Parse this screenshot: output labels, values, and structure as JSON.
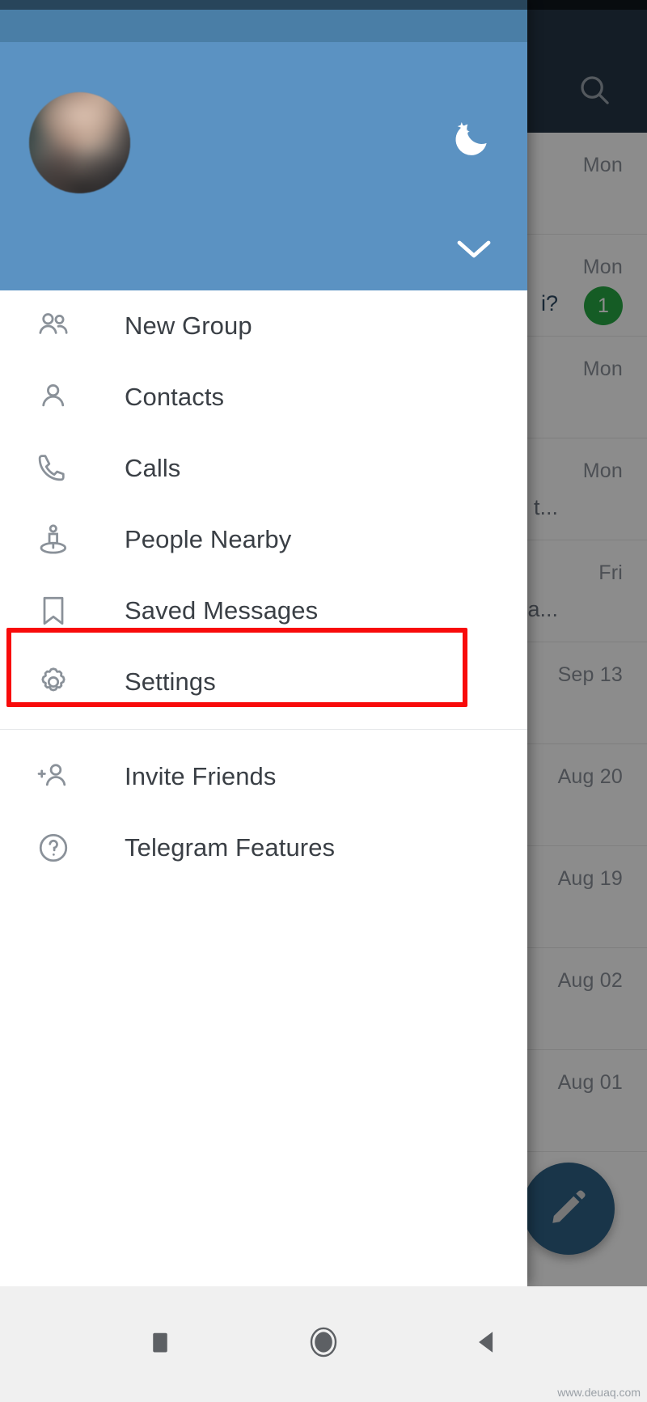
{
  "app": {
    "name": "Telegram",
    "watermark": "www.deuaq.com"
  },
  "background_app": {
    "header": {
      "search_icon": "search-icon"
    },
    "chat_rows": [
      {
        "date": "Mon",
        "preview": "",
        "badge": ""
      },
      {
        "date": "Mon",
        "preview": "i?",
        "badge": "1"
      },
      {
        "date": "Mon",
        "preview": "",
        "badge": ""
      },
      {
        "date": "Mon",
        "preview": "l me t...",
        "badge": ""
      },
      {
        "date": "Fri",
        "preview": "ted a...",
        "badge": ""
      },
      {
        "date": "Sep 13",
        "preview": "",
        "badge": ""
      },
      {
        "date": "Aug 20",
        "preview": "",
        "badge": ""
      },
      {
        "date": "Aug 19",
        "preview": "",
        "badge": ""
      },
      {
        "date": "Aug 02",
        "preview": "",
        "badge": ""
      },
      {
        "date": "Aug 01",
        "preview": "",
        "badge": ""
      }
    ],
    "fab": {
      "icon": "pencil-icon",
      "color": "#2e6186"
    }
  },
  "drawer": {
    "header": {
      "avatar": "user-avatar",
      "night_mode_icon": "moon-icon",
      "expand_icon": "chevron-down-icon",
      "background_color": "#5b92c2"
    },
    "items": [
      {
        "label": "New Group",
        "icon": "group-icon"
      },
      {
        "label": "Contacts",
        "icon": "person-icon"
      },
      {
        "label": "Calls",
        "icon": "phone-icon"
      },
      {
        "label": "People Nearby",
        "icon": "people-nearby-icon"
      },
      {
        "label": "Saved Messages",
        "icon": "bookmark-icon"
      },
      {
        "label": "Settings",
        "icon": "gear-icon"
      }
    ],
    "secondary_items": [
      {
        "label": "Invite Friends",
        "icon": "add-person-icon"
      },
      {
        "label": "Telegram Features",
        "icon": "question-mark-icon"
      }
    ],
    "highlight": {
      "target": "Settings",
      "color": "#f80b0b"
    }
  },
  "navbar": {
    "buttons": [
      {
        "name": "recents-button",
        "icon": "square-icon"
      },
      {
        "name": "home-button",
        "icon": "circle-icon"
      },
      {
        "name": "back-button",
        "icon": "triangle-left-icon"
      }
    ]
  }
}
